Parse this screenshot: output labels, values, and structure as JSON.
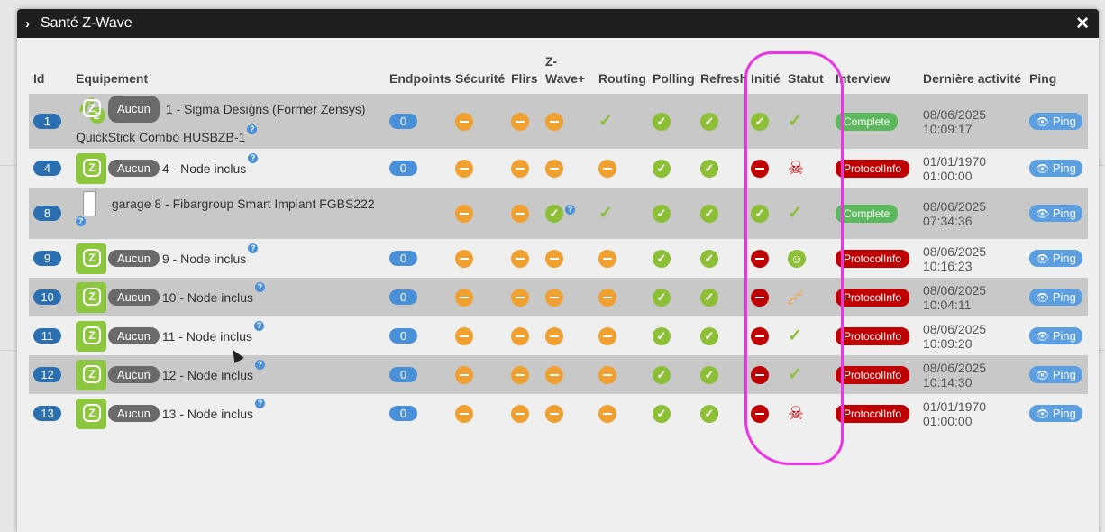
{
  "window": {
    "title": "Santé Z-Wave"
  },
  "columns": [
    "Id",
    "Equipement",
    "Endpoints",
    "Sécurité",
    "Flirs",
    "Z-Wave+",
    "Routing",
    "Polling",
    "Refresh",
    "Initié",
    "Statut",
    "Interview",
    "Dernière activité",
    "Ping"
  ],
  "aucun_label": "Aucun",
  "ping_label": "Ping",
  "rows": [
    {
      "id": "1",
      "name": "1 - Sigma Designs (Former Zensys) QuickStick Combo HUSBZB-1",
      "endpoints": "0",
      "interview": "Complete",
      "date": "08/06/2025",
      "time": "10:09:17"
    },
    {
      "id": "4",
      "name": "4 - Node inclus",
      "endpoints": "0",
      "interview": "ProtocolInfo",
      "date": "01/01/1970",
      "time": "01:00:00"
    },
    {
      "id": "8",
      "name": "garage 8 - Fibargroup Smart Implant FGBS222",
      "endpoints": "",
      "interview": "Complete",
      "date": "08/06/2025",
      "time": "07:34:36"
    },
    {
      "id": "9",
      "name": "9 - Node inclus",
      "endpoints": "0",
      "interview": "ProtocolInfo",
      "date": "08/06/2025",
      "time": "10:16:23"
    },
    {
      "id": "10",
      "name": "10 - Node inclus",
      "endpoints": "0",
      "interview": "ProtocolInfo",
      "date": "08/06/2025",
      "time": "10:04:11"
    },
    {
      "id": "11",
      "name": "11 - Node inclus",
      "endpoints": "0",
      "interview": "ProtocolInfo",
      "date": "08/06/2025",
      "time": "10:09:20"
    },
    {
      "id": "12",
      "name": "12 - Node inclus",
      "endpoints": "0",
      "interview": "ProtocolInfo",
      "date": "08/06/2025",
      "time": "10:14:30"
    },
    {
      "id": "13",
      "name": "13 - Node inclus",
      "endpoints": "0",
      "interview": "ProtocolInfo",
      "date": "01/01/1970",
      "time": "01:00:00"
    }
  ],
  "colors": {
    "accent": "#4a90d9",
    "ok": "#8cbe36",
    "warn": "#f0a030",
    "error": "#c00000",
    "annotation": "#ee33e6"
  }
}
